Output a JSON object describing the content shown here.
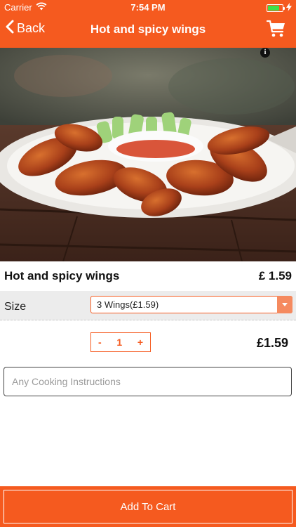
{
  "status": {
    "carrier": "Carrier",
    "time": "7:54 PM"
  },
  "nav": {
    "back_label": "Back",
    "title": "Hot and spicy wings"
  },
  "item": {
    "name": "Hot and spicy wings",
    "price": "£ 1.59"
  },
  "size": {
    "label": "Size",
    "selected": "3 Wings(£1.59)"
  },
  "quantity": {
    "minus": "-",
    "value": "1",
    "plus": "+",
    "total": "£1.59"
  },
  "instructions": {
    "placeholder": "Any Cooking Instructions",
    "value": ""
  },
  "footer": {
    "add_to_cart_label": "Add To Cart"
  },
  "icons": {
    "info": "i",
    "wifi": "wifi-icon",
    "battery": "battery-icon",
    "charging": "bolt-icon",
    "back": "chevron-left-icon",
    "cart": "cart-icon"
  },
  "colors": {
    "brand": "#f55a1f",
    "battery": "#3ee04a",
    "select_arrow": "#f58a5f"
  },
  "battery_level": 0.8
}
